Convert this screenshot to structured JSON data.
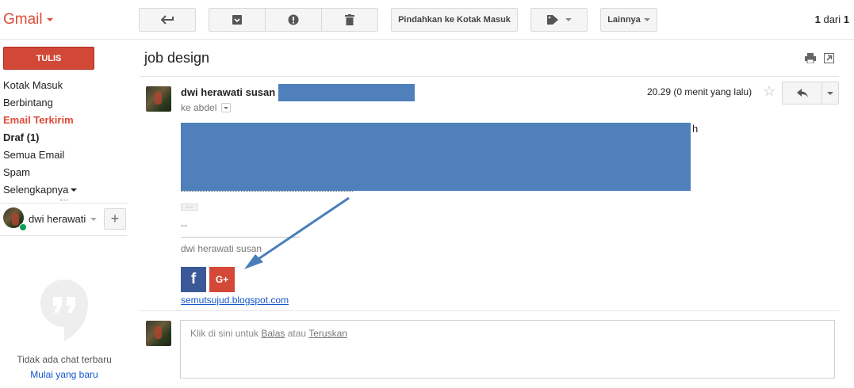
{
  "brand": {
    "logo": "Gmail"
  },
  "toolbar": {
    "move_inbox_label": "Pindahkan ke Kotak Masuk",
    "more_label": "Lainnya",
    "pagination_current": "1",
    "pagination_sep": " dari ",
    "pagination_total": "1"
  },
  "sidebar": {
    "compose_label": "TULIS",
    "items": [
      {
        "label": "Kotak Masuk"
      },
      {
        "label": "Berbintang"
      },
      {
        "label": "Email Terkirim"
      },
      {
        "label": "Draf (1)"
      },
      {
        "label": "Semua Email"
      },
      {
        "label": "Spam"
      },
      {
        "label": "Selengkapnya"
      }
    ],
    "hangouts_user": "dwi herawati",
    "chat_empty": "Tidak ada chat terbaru",
    "chat_start": "Mulai yang baru"
  },
  "message": {
    "subject": "job design",
    "sender_name": "dwi herawati susan",
    "recipient": "ke abdel",
    "time": "20.29 (0 menit yang lalu)",
    "body_trailing_char": "h",
    "ellipsis": "···",
    "sig_dashes": "--",
    "sig_line": "________________________________",
    "sig_name": "dwi herawati susan",
    "facebook_glyph": "f",
    "gplus_glyph": "G+",
    "blog_link": "semutsujud.blogspot.com"
  },
  "reply_box": {
    "prefix": "Klik di sini untuk ",
    "reply_link": "Balas",
    "middle": " atau ",
    "forward_link": "Teruskan"
  },
  "colors": {
    "brand_red": "#dd4b39",
    "redaction_blue": "#4f80bb",
    "link_blue": "#1155cc",
    "facebook_blue": "#3b5998",
    "gplus_red": "#d34836",
    "annotation_arrow": "#4a7ebb"
  }
}
